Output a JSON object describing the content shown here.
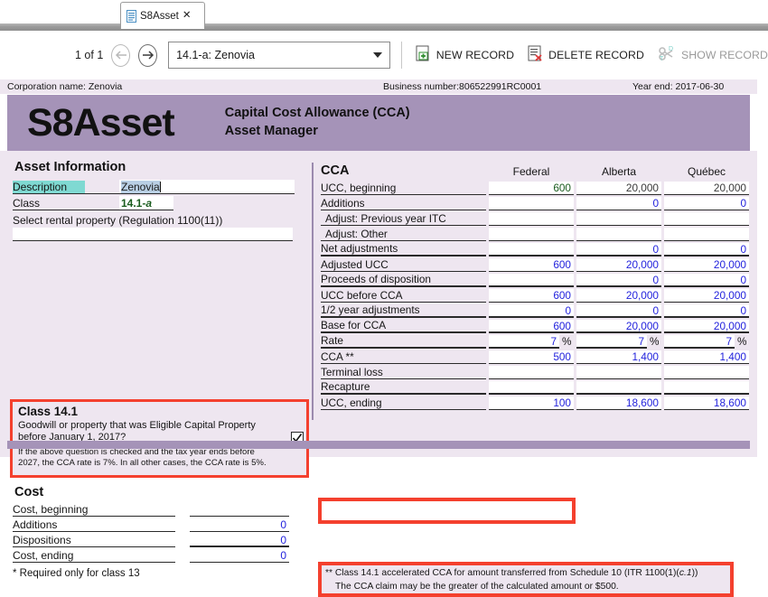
{
  "tab": {
    "label": "S8Asset",
    "close": "✕",
    "icon": "document-icon"
  },
  "toolbar": {
    "pager": "1 of 1",
    "prev_icon": "arrow-left-icon",
    "next_icon": "arrow-right-icon",
    "record_selector": "14.1-a: Zenovia",
    "new_record": "NEW RECORD",
    "delete_record": "DELETE RECORD",
    "show_record": "SHOW RECORD"
  },
  "corpbar": {
    "corporation": "Corporation name: Zenovia",
    "business_number": "Business number:806522991RC0001",
    "year_end": "Year end: 2017-06-30"
  },
  "banner": {
    "title": "S8Asset",
    "subtitle_line1": "Capital Cost Allowance (CCA)",
    "subtitle_line2": "Asset Manager",
    "color": "#a593b8"
  },
  "asset_information": {
    "heading": "Asset Information",
    "description_label": "Description",
    "description_value": "Zenovia",
    "class_label": "Class",
    "class_value_main": "14.1",
    "class_value_suffix": "-a",
    "rental_label": "Select rental property (Regulation 1100(11))",
    "rental_value": ""
  },
  "class141": {
    "heading": "Class 14.1",
    "question_line1": "Goodwill or property that was Eligible Capital Property",
    "question_line2": "before January 1, 2017?",
    "checked": "✓",
    "note_line1": "If the above question is checked and the tax year ends before",
    "note_line2": "2027, the CCA rate is 7%. In all other cases, the CCA rate is 5%."
  },
  "cost": {
    "heading": "Cost",
    "rows": [
      {
        "label": "Cost, beginning",
        "value": ""
      },
      {
        "label": "Additions",
        "value": "0"
      },
      {
        "label": "Dispositions",
        "value": "0"
      },
      {
        "label": "Cost, ending",
        "value": "0"
      }
    ],
    "footnote": "* Required only for class 13"
  },
  "cca": {
    "heading": "CCA",
    "columns": [
      "Federal",
      "Alberta",
      "Québec"
    ],
    "rows": [
      {
        "label": "UCC, beginning",
        "federal": "600",
        "alberta": "20,000",
        "quebec": "20,000",
        "color": "green"
      },
      {
        "label": "Additions",
        "federal": "",
        "alberta": "0",
        "quebec": "0",
        "color": "blue"
      },
      {
        "label": "Adjust: Previous year ITC",
        "federal": "",
        "alberta": "",
        "quebec": "",
        "color": "blue"
      },
      {
        "label": "Adjust: Other",
        "federal": "",
        "alberta": "",
        "quebec": "",
        "color": "blue"
      },
      {
        "label": "Net adjustments",
        "federal": "",
        "alberta": "0",
        "quebec": "0",
        "color": "blue"
      },
      {
        "label": "Adjusted UCC",
        "federal": "600",
        "alberta": "20,000",
        "quebec": "20,000",
        "color": "blue"
      },
      {
        "label": "Proceeds of disposition",
        "federal": "",
        "alberta": "0",
        "quebec": "0",
        "color": "blue"
      },
      {
        "label": "UCC before CCA",
        "federal": "600",
        "alberta": "20,000",
        "quebec": "20,000",
        "color": "blue"
      },
      {
        "label": "1/2 year adjustments",
        "federal": "0",
        "alberta": "0",
        "quebec": "0",
        "color": "blue"
      },
      {
        "label": "Base for CCA",
        "federal": "600",
        "alberta": "20,000",
        "quebec": "20,000",
        "color": "blue"
      },
      {
        "label": "Rate",
        "federal": "7",
        "alberta": "7",
        "quebec": "7",
        "color": "blue"
      },
      {
        "label": "CCA **",
        "federal": "500",
        "alberta": "1,400",
        "quebec": "1,400",
        "color": "blue"
      },
      {
        "label": "Terminal loss",
        "federal": "",
        "alberta": "",
        "quebec": "",
        "color": "blue"
      },
      {
        "label": "Recapture",
        "federal": "",
        "alberta": "",
        "quebec": "",
        "color": "blue"
      },
      {
        "label": "UCC, ending",
        "federal": "100",
        "alberta": "18,600",
        "quebec": "18,600",
        "color": "blue"
      }
    ],
    "percent_sign": "%"
  },
  "footnote": {
    "line1_a": "** Class 14.1 accelerated CCA for amount transferred from Schedule 10 (ITR 1100(1)(",
    "line1_i": "c.1",
    "line1_b": "))",
    "line2": "The CCA claim may be the greater of the calculated amount or $500."
  },
  "highlight_color": "#f4402e"
}
